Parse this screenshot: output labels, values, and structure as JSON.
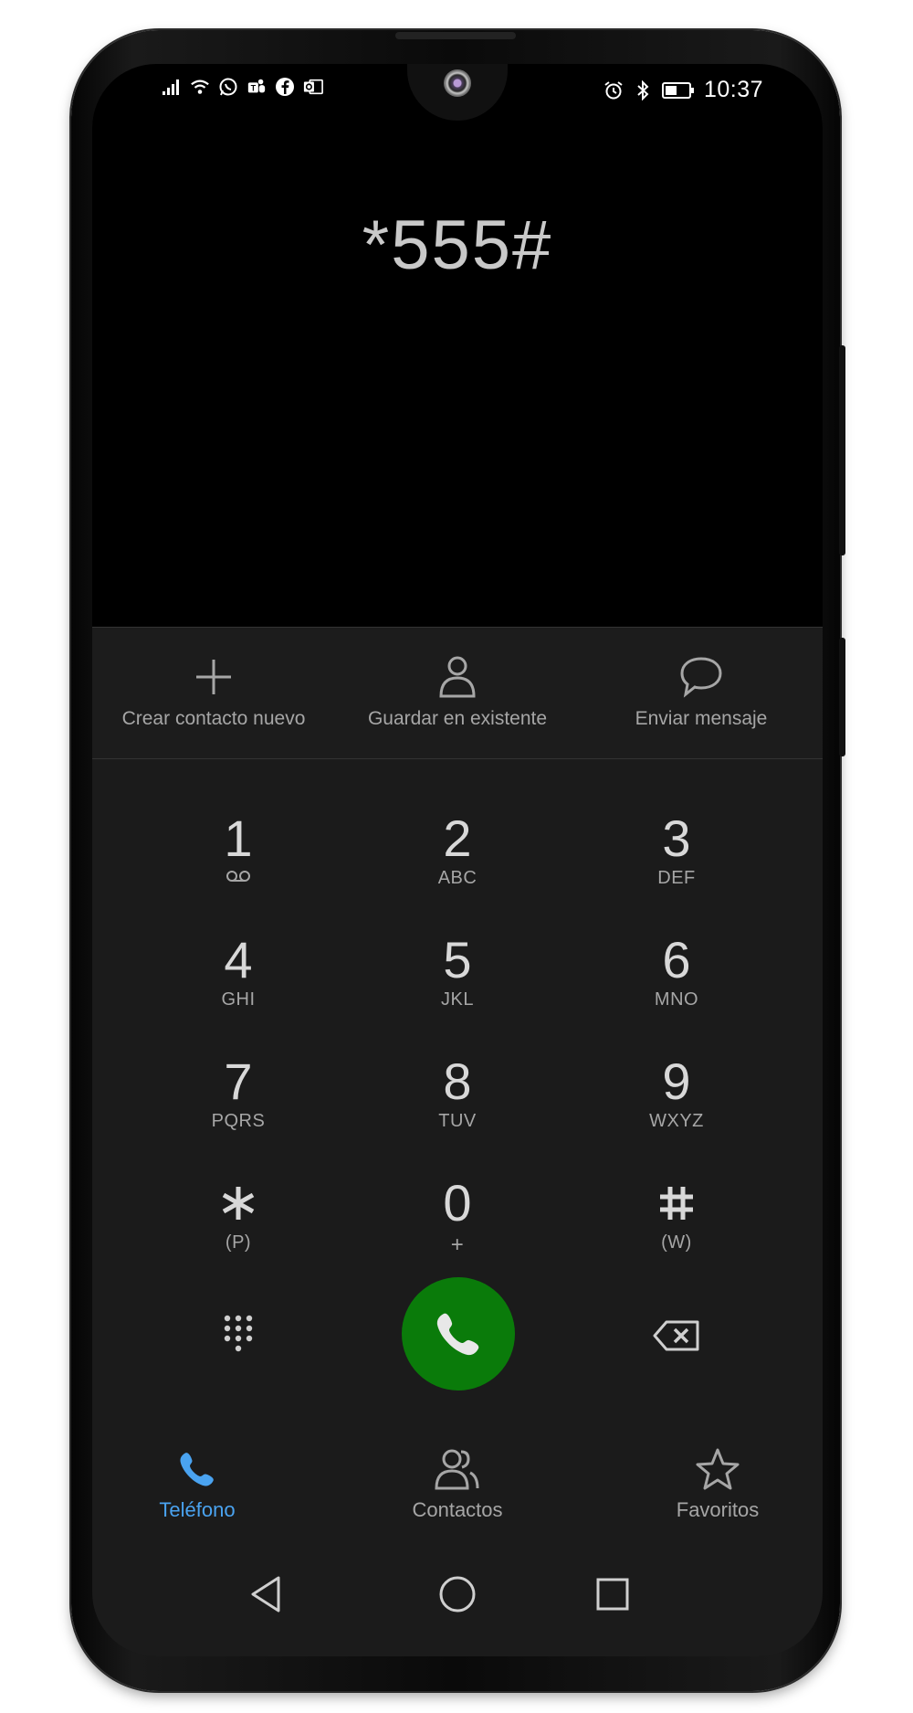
{
  "status_bar": {
    "time": "10:37",
    "left_icons": [
      "signal-icon",
      "wifi-icon",
      "whatsapp-icon",
      "teams-icon",
      "facebook-icon",
      "outlook-icon"
    ],
    "right_icons": [
      "alarm-icon",
      "bluetooth-icon",
      "battery-icon"
    ]
  },
  "dialer": {
    "number": "*555#"
  },
  "actions": [
    {
      "label": "Crear contacto nuevo",
      "icon": "plus-icon"
    },
    {
      "label": "Guardar en existente",
      "icon": "person-icon"
    },
    {
      "label": "Enviar mensaje",
      "icon": "message-icon"
    }
  ],
  "keypad": [
    {
      "digit": "1",
      "sub": ""
    },
    {
      "digit": "2",
      "sub": "ABC"
    },
    {
      "digit": "3",
      "sub": "DEF"
    },
    {
      "digit": "4",
      "sub": "GHI"
    },
    {
      "digit": "5",
      "sub": "JKL"
    },
    {
      "digit": "6",
      "sub": "MNO"
    },
    {
      "digit": "7",
      "sub": "PQRS"
    },
    {
      "digit": "8",
      "sub": "TUV"
    },
    {
      "digit": "9",
      "sub": "WXYZ"
    },
    {
      "digit": "",
      "sub": "(P)"
    },
    {
      "digit": "0",
      "sub": "+"
    },
    {
      "digit": "",
      "sub": "(W)"
    }
  ],
  "tabs": [
    {
      "label": "Teléfono",
      "icon": "phone-icon",
      "active": true
    },
    {
      "label": "Contactos",
      "icon": "contacts-icon",
      "active": false
    },
    {
      "label": "Favoritos",
      "icon": "star-icon",
      "active": false
    }
  ],
  "colors": {
    "call_button": "#0a7b0a",
    "active_tab": "#4aa3f0",
    "screen_bg": "#1b1b1b",
    "text_secondary": "#a6a6a6"
  }
}
